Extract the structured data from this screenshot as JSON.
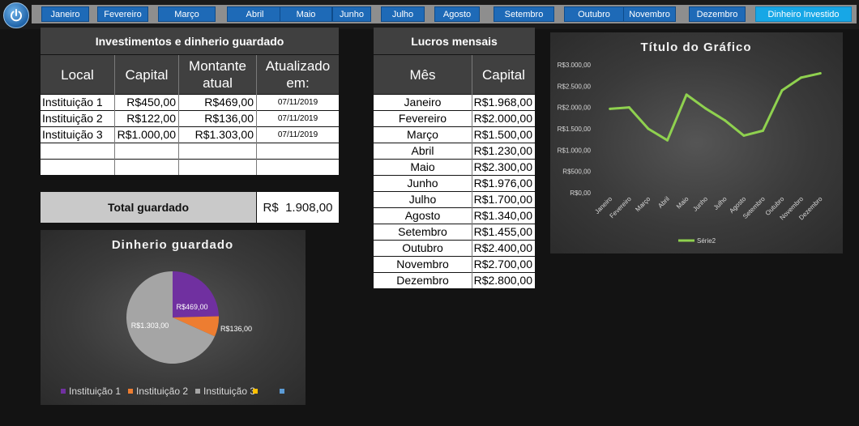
{
  "nav": {
    "power_icon": "power-icon",
    "months": [
      "Janeiro",
      "Fevereiro",
      "Março",
      "Abril",
      "Maio",
      "Junho",
      "Julho",
      "Agosto",
      "Setembro",
      "Outubro",
      "Novembro",
      "Dezembro"
    ],
    "invested_label": "Dinheiro Investido",
    "colors": {
      "button": "#1e6ab7",
      "accent": "#17a7e6"
    }
  },
  "investments": {
    "title": "Investimentos e dinherio guardado",
    "headers": [
      "Local",
      "Capital",
      "Montante atual",
      "Atualizado em:"
    ],
    "rows": [
      [
        "Instituição 1",
        "R$450,00",
        "R$469,00",
        "07/11/2019"
      ],
      [
        "Instituição 2",
        "R$122,00",
        "R$136,00",
        "07/11/2019"
      ],
      [
        "Instituição 3",
        "R$1.000,00",
        "R$1.303,00",
        "07/11/2019"
      ],
      [
        "",
        "",
        "",
        ""
      ],
      [
        "",
        "",
        "",
        ""
      ]
    ]
  },
  "total": {
    "label": "Total guardado",
    "currency": "R$",
    "value": "1.908,00"
  },
  "monthly": {
    "title": "Lucros mensais",
    "headers": [
      "Mês",
      "Capital"
    ],
    "rows": [
      [
        "Janeiro",
        "R$1.968,00"
      ],
      [
        "Fevereiro",
        "R$2.000,00"
      ],
      [
        "Março",
        "R$1.500,00"
      ],
      [
        "Abril",
        "R$1.230,00"
      ],
      [
        "Maio",
        "R$2.300,00"
      ],
      [
        "Junho",
        "R$1.976,00"
      ],
      [
        "Julho",
        "R$1.700,00"
      ],
      [
        "Agosto",
        "R$1.340,00"
      ],
      [
        "Setembro",
        "R$1.455,00"
      ],
      [
        "Outubro",
        "R$2.400,00"
      ],
      [
        "Novembro",
        "R$2.700,00"
      ],
      [
        "Dezembro",
        "R$2.800,00"
      ]
    ]
  },
  "chart_data": [
    {
      "type": "pie",
      "title": "Dinherio guardado",
      "categories": [
        "Instituição 1",
        "Instituição 2",
        "Instituição 3",
        "",
        ""
      ],
      "values": [
        469,
        136,
        1303,
        0,
        0
      ],
      "data_labels": [
        "R$469,00",
        "R$136,00",
        "R$1.303,00"
      ],
      "colors": [
        "#7030a0",
        "#ed7d31",
        "#a5a5a5",
        "#ffc000",
        "#5b9bd5"
      ],
      "legend": "bottom"
    },
    {
      "type": "line",
      "title": "Título do Gráfico",
      "categories": [
        "Janeiro",
        "Fevereiro",
        "Março",
        "Abril",
        "Maio",
        "Junho",
        "Julho",
        "Agosto",
        "Setembro",
        "Outubro",
        "Novembro",
        "Dezembro"
      ],
      "series": [
        {
          "name": "Série2",
          "values": [
            1968,
            2000,
            1500,
            1230,
            2300,
            1976,
            1700,
            1340,
            1455,
            2400,
            2700,
            2800
          ],
          "color": "#8fd14f"
        }
      ],
      "ylim": [
        0,
        3000
      ],
      "yticks": [
        "R$0,00",
        "R$500,00",
        "R$1.000,00",
        "R$1.500,00",
        "R$2.000,00",
        "R$2.500,00",
        "R$3.000,00"
      ],
      "legend": "bottom",
      "grid": false
    }
  ]
}
